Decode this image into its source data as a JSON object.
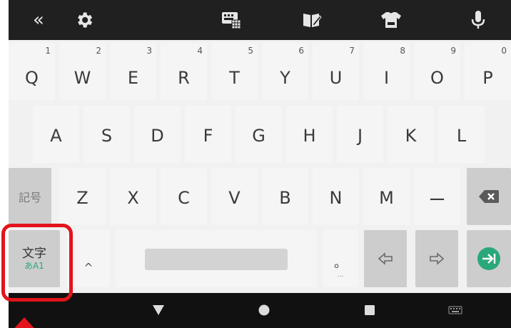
{
  "colors": {
    "accent": "#2aa87a",
    "highlight": "#e3141b",
    "toolbar_icon": "#e6e6e6"
  },
  "toolbar": {
    "icons": [
      "collapse-icon",
      "gear-icon",
      "keyboard-layout-icon",
      "dictionary-edit-icon",
      "theme-icon",
      "microphone-icon"
    ],
    "collapse_label": "«"
  },
  "keyboard": {
    "row1": [
      {
        "label": "Q",
        "hint": "1"
      },
      {
        "label": "W",
        "hint": "2"
      },
      {
        "label": "E",
        "hint": "3"
      },
      {
        "label": "R",
        "hint": "4"
      },
      {
        "label": "T",
        "hint": "5"
      },
      {
        "label": "Y",
        "hint": "6"
      },
      {
        "label": "U",
        "hint": "7"
      },
      {
        "label": "I",
        "hint": "8"
      },
      {
        "label": "O",
        "hint": "9"
      },
      {
        "label": "P",
        "hint": "0"
      }
    ],
    "row2": [
      "A",
      "S",
      "D",
      "F",
      "G",
      "H",
      "J",
      "K",
      "L"
    ],
    "row3": {
      "symbol_key": "記号",
      "letters": [
        "Z",
        "X",
        "C",
        "V",
        "B",
        "N",
        "M",
        "ー"
      ]
    },
    "row4": {
      "mode_key_main": "文字",
      "mode_key_sub": "あA1",
      "caret_key": "^",
      "period_key": "。",
      "period_sub": "…"
    }
  },
  "navbar": {
    "icons": [
      "back-triangle-icon",
      "home-circle-icon",
      "recents-square-icon",
      "keyboard-switch-icon"
    ]
  }
}
